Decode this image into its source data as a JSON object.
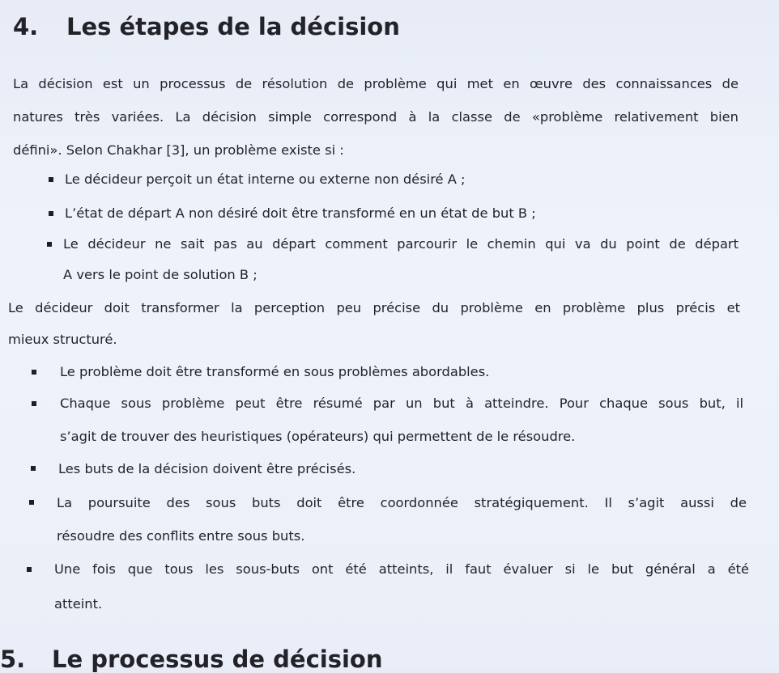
{
  "section4": {
    "number": "4.",
    "title": "Les étapes de la décision"
  },
  "intro": {
    "line1": "La décision est un processus de résolution de problème qui met en œuvre des connaissances de",
    "line2": "natures très variées. La décision simple correspond à la classe de «problème relativement bien",
    "line3": "défini». Selon Chakhar [3], un problème existe si :"
  },
  "conditions": [
    {
      "lines": [
        "Le décideur perçoit un état interne ou externe non désiré A ;"
      ]
    },
    {
      "lines": [
        "L’état de départ A non désiré doit être transformé en un état de but B ;"
      ]
    },
    {
      "lines": [
        "Le décideur ne sait pas au départ comment parcourir le chemin qui va du point de départ",
        "A vers le point de solution B ;"
      ]
    }
  ],
  "transition": {
    "line1": "Le décideur doit transformer la perception peu précise du problème en problème plus précis et",
    "line2": "mieux structuré."
  },
  "steps": [
    {
      "lines": [
        "Le problème doit être transformé en sous problèmes abordables."
      ]
    },
    {
      "lines": [
        "Chaque sous problème peut être résumé par un but à atteindre. Pour chaque sous but, il",
        "s’agit de trouver des heuristiques (opérateurs) qui permettent de le résoudre."
      ]
    },
    {
      "lines": [
        "Les buts de la décision doivent être précisés."
      ]
    },
    {
      "lines": [
        "La poursuite des sous buts doit être coordonnée stratégiquement. Il s’agit aussi de",
        "résoudre des conflits entre sous buts."
      ]
    },
    {
      "lines": [
        "Une fois que tous les sous-buts ont été atteints, il faut évaluer si le but général a été",
        "atteint."
      ]
    }
  ],
  "section5": {
    "number": "5.",
    "title": "Le processus de décision"
  }
}
